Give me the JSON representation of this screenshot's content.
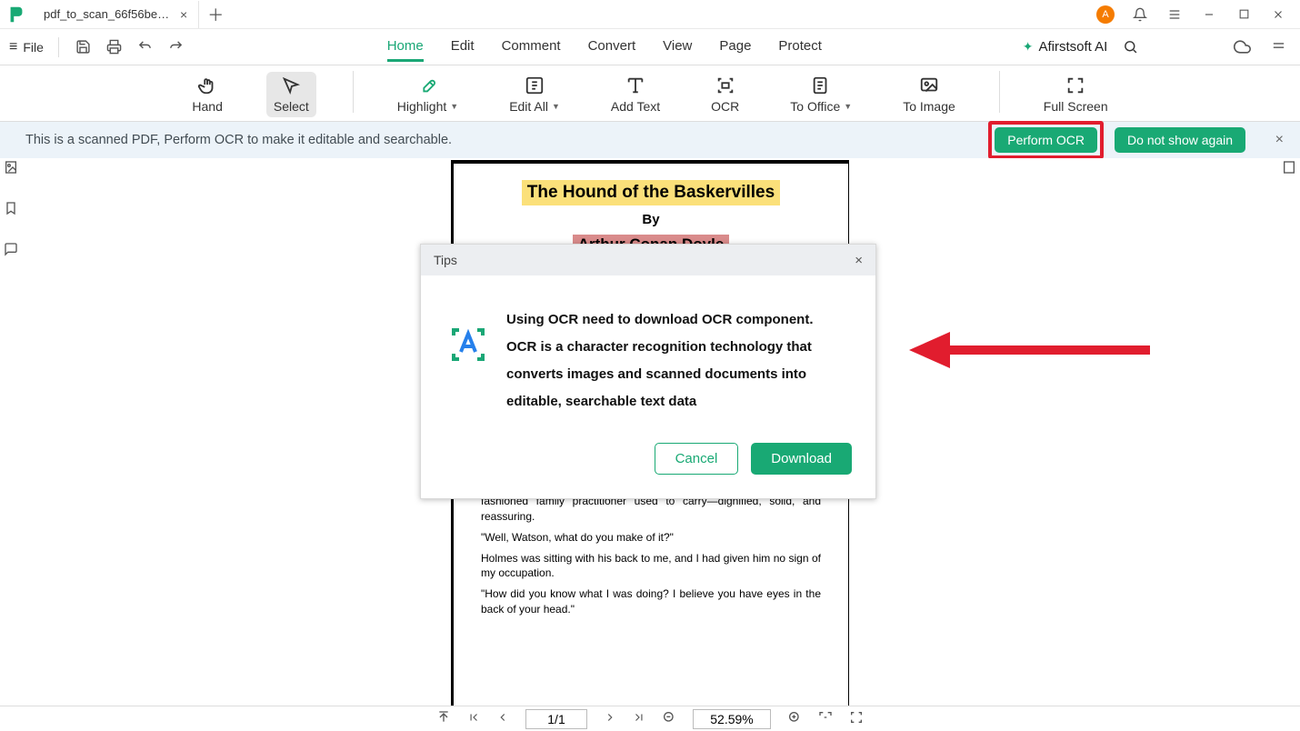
{
  "titlebar": {
    "tab_title": "pdf_to_scan_66f56be9d8...",
    "avatar_letter": "A"
  },
  "menubar": {
    "file_label": "File",
    "tabs": [
      "Home",
      "Edit",
      "Comment",
      "Convert",
      "View",
      "Page",
      "Protect"
    ],
    "active_tab": "Home",
    "ai_label": "Afirstsoft AI"
  },
  "ribbon": {
    "hand": "Hand",
    "select": "Select",
    "highlight": "Highlight",
    "edit_all": "Edit All",
    "add_text": "Add Text",
    "ocr": "OCR",
    "to_office": "To Office",
    "to_image": "To Image",
    "full_screen": "Full Screen"
  },
  "notif": {
    "message": "This is a scanned PDF, Perform OCR to make it editable and searchable.",
    "perform": "Perform OCR",
    "dont_show": "Do not show again"
  },
  "document": {
    "title": "The Hound of the Baskervilles",
    "by": "By",
    "author": "Arthur Conan Doyle",
    "p1": "the head was a broad silver band nearly an inch across. \"To James Mortimer, M.R.C.S., from his friends of the C.C.H.,\" was engraved upon it, with the date \"1884.\" It was just such a stick as the old-fashioned family practitioner used to carry—dignified, solid, and reassuring.",
    "p2": "\"Well, Watson, what do you make of it?\"",
    "p3": "Holmes was sitting with his back to me, and I had given him no sign of my occupation.",
    "p4": "\"How did you know what I was doing? I believe you have eyes in the back of your head.\""
  },
  "dialog": {
    "title": "Tips",
    "line1": "Using OCR need to download OCR component.",
    "line2": "OCR is a character recognition technology that converts images and scanned documents into editable, searchable text data",
    "cancel": "Cancel",
    "download": "Download"
  },
  "statusbar": {
    "page": "1/1",
    "zoom": "52.59%"
  }
}
